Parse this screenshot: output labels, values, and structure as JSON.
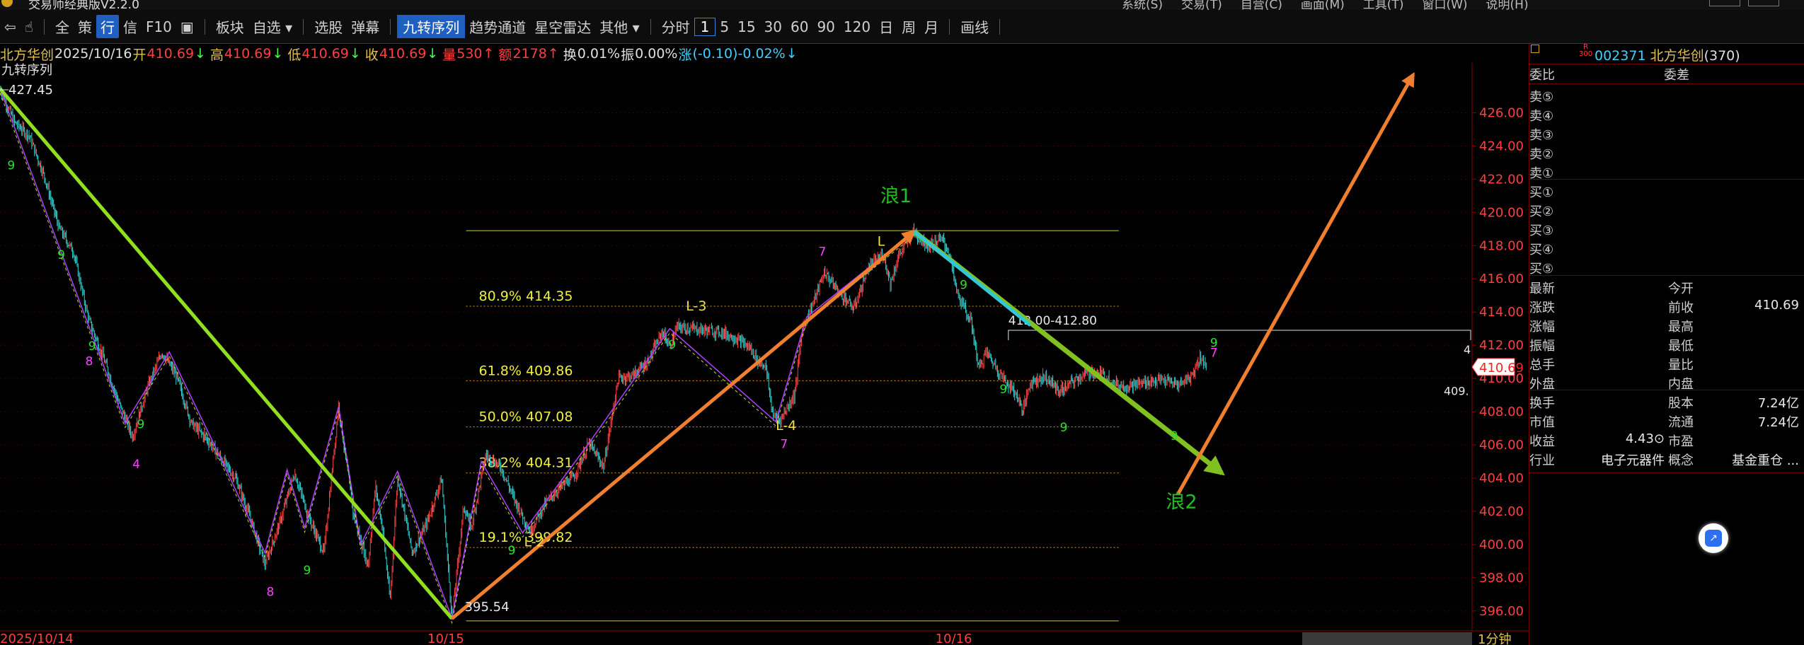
{
  "window": {
    "title": "交易师经典版V2.2.0",
    "menu": [
      "系统(S)",
      "交易(T)",
      "自营(C)",
      "画面(M)",
      "工具(T)",
      "窗口(W)",
      "说明(H)"
    ]
  },
  "toolbar": {
    "items": [
      "板块",
      "自选",
      "选股",
      "弹幕",
      "九转序列",
      "趋势通道",
      "星空雷达",
      "其他",
      "分时",
      "1",
      "5",
      "15",
      "30",
      "60",
      "90",
      "120",
      "日",
      "周",
      "月",
      "画线"
    ],
    "left_icons": [
      "back-icon",
      "pointer-icon"
    ],
    "quick": [
      "全",
      "策",
      "行",
      "信",
      "F10"
    ]
  },
  "stock": {
    "name": "北方华创",
    "code": "002371",
    "count": "(370)",
    "market_tag_top": "R",
    "market_tag_bottom": "300"
  },
  "infoline": [
    {
      "text": "北方华创",
      "color": "#e0c050"
    },
    {
      "text": "2025/10/16",
      "color": "#e0e0e0"
    },
    {
      "text": "开",
      "color": "#e0c050"
    },
    {
      "text": "410.69",
      "color": "#ff4040"
    },
    {
      "text": "↓",
      "color": "#40ff40"
    },
    {
      "text": "高",
      "color": "#e0c050"
    },
    {
      "text": "410.69",
      "color": "#ff4040"
    },
    {
      "text": "↓",
      "color": "#40ff40"
    },
    {
      "text": "低",
      "color": "#e0c050"
    },
    {
      "text": "410.69",
      "color": "#ff4040"
    },
    {
      "text": "↓",
      "color": "#40ff40"
    },
    {
      "text": "收",
      "color": "#e0c050"
    },
    {
      "text": "410.69",
      "color": "#ff4040"
    },
    {
      "text": "↓",
      "color": "#40ff40"
    },
    {
      "text": "量",
      "color": "#ff4040"
    },
    {
      "text": "530",
      "color": "#ff4040"
    },
    {
      "text": "↑",
      "color": "#ff4040"
    },
    {
      "text": "额",
      "color": "#ff4040"
    },
    {
      "text": "2178",
      "color": "#ff4040"
    },
    {
      "text": "↑",
      "color": "#ff4040"
    },
    {
      "text": "换",
      "color": "#e0e0e0"
    },
    {
      "text": "0.01%",
      "color": "#e0e0e0"
    },
    {
      "text": "振",
      "color": "#e0e0e0"
    },
    {
      "text": "0.00%",
      "color": "#e0e0e0"
    },
    {
      "text": "涨",
      "color": "#40d0ff"
    },
    {
      "text": "(-0.10)-0.02%",
      "color": "#40d0ff"
    },
    {
      "text": "↓",
      "color": "#40d0ff"
    }
  ],
  "chart_data": {
    "type": "line",
    "title": "",
    "indicator_label": "九转序列",
    "period_label": "1分钟",
    "max_label": "427.45",
    "min_label": "395.54",
    "x_ticks": [
      "2025/10/14",
      "10/15",
      "10/16"
    ],
    "y_ticks": [
      "426.00",
      "424.00",
      "422.00",
      "420.00",
      "418.00",
      "416.00",
      "414.00",
      "412.00",
      "410.00",
      "408.00",
      "406.00",
      "404.00",
      "402.00",
      "400.00",
      "398.00",
      "396.00"
    ],
    "ylim": [
      394.8,
      429.0
    ],
    "last_price": "410.69",
    "last_price_value": 410.69,
    "fib_levels": [
      {
        "label": "80.9% 414.35",
        "value": 414.35
      },
      {
        "label": "61.8% 409.86",
        "value": 409.86
      },
      {
        "label": "50.0% 407.08",
        "value": 407.08
      },
      {
        "label": "38.2% 404.31",
        "value": 404.31
      },
      {
        "label": "19.1% 399.82",
        "value": 399.82
      }
    ],
    "fib_top": 418.9,
    "fib_bottom": 395.4,
    "range_label": "413.00-412.80",
    "small_label_right": "409.",
    "small_label_right2": "4",
    "wave_labels": [
      {
        "text": "浪1",
        "t": 0.598,
        "v": 420.6,
        "color": "#20c020"
      },
      {
        "text": "浪2",
        "t": 0.792,
        "v": 402.2,
        "color": "#20c020"
      }
    ],
    "swing_labels": [
      {
        "text": "L-3",
        "t": 0.466,
        "v": 414.1,
        "color": "#f0e040"
      },
      {
        "text": "L-2",
        "t": 0.356,
        "v": 399.9,
        "color": "#f0e040"
      },
      {
        "text": "L-4",
        "t": 0.527,
        "v": 406.9,
        "color": "#f0e040"
      },
      {
        "text": "L",
        "t": 0.596,
        "v": 418.0,
        "color": "#f0e040"
      }
    ],
    "trend_lines": [
      {
        "from": [
          0.0,
          427.45
        ],
        "to": [
          0.307,
          395.54
        ],
        "color": "#90e020",
        "width": 5
      },
      {
        "from": [
          0.307,
          395.54
        ],
        "to": [
          0.621,
          418.85
        ],
        "color": "#f08030",
        "width": 5
      },
      {
        "from": [
          0.621,
          418.85
        ],
        "to": [
          0.83,
          404.3
        ],
        "color": "#80c020",
        "width": 7
      },
      {
        "from": [
          0.621,
          418.85
        ],
        "to": [
          0.7,
          413.2
        ],
        "color": "#30c8d8",
        "width": 5
      },
      {
        "from": [
          0.8,
          403.0
        ],
        "to": [
          0.96,
          428.3
        ],
        "color": "#f08030",
        "width": 5
      }
    ],
    "price_path": [
      [
        0.0,
        427.45
      ],
      [
        0.01,
        425.4
      ],
      [
        0.02,
        424.6
      ],
      [
        0.03,
        422.2
      ],
      [
        0.04,
        419.1
      ],
      [
        0.05,
        417.6
      ],
      [
        0.06,
        413.6
      ],
      [
        0.07,
        411.3
      ],
      [
        0.08,
        408.7
      ],
      [
        0.09,
        406.5
      ],
      [
        0.1,
        409.4
      ],
      [
        0.11,
        411.6
      ],
      [
        0.12,
        410.1
      ],
      [
        0.13,
        407.3
      ],
      [
        0.14,
        406.4
      ],
      [
        0.15,
        405.2
      ],
      [
        0.16,
        404.0
      ],
      [
        0.17,
        401.6
      ],
      [
        0.18,
        398.8
      ],
      [
        0.19,
        401.3
      ],
      [
        0.2,
        404.3
      ],
      [
        0.21,
        401.6
      ],
      [
        0.22,
        399.5
      ],
      [
        0.23,
        408.4
      ],
      [
        0.24,
        401.8
      ],
      [
        0.25,
        398.7
      ],
      [
        0.255,
        403.5
      ],
      [
        0.26,
        400.9
      ],
      [
        0.265,
        396.6
      ],
      [
        0.27,
        404.1
      ],
      [
        0.28,
        399.5
      ],
      [
        0.29,
        401.3
      ],
      [
        0.3,
        404.0
      ],
      [
        0.307,
        395.54
      ],
      [
        0.315,
        402.3
      ],
      [
        0.32,
        401.0
      ],
      [
        0.33,
        405.4
      ],
      [
        0.34,
        404.7
      ],
      [
        0.35,
        402.6
      ],
      [
        0.355,
        401.7
      ],
      [
        0.36,
        400.8
      ],
      [
        0.37,
        402.4
      ],
      [
        0.38,
        403.4
      ],
      [
        0.39,
        404.1
      ],
      [
        0.4,
        406.1
      ],
      [
        0.41,
        404.7
      ],
      [
        0.42,
        410.0
      ],
      [
        0.43,
        410.2
      ],
      [
        0.44,
        411.0
      ],
      [
        0.45,
        412.8
      ],
      [
        0.455,
        411.9
      ],
      [
        0.46,
        413.1
      ],
      [
        0.47,
        413.0
      ],
      [
        0.48,
        412.9
      ],
      [
        0.49,
        412.8
      ],
      [
        0.5,
        412.4
      ],
      [
        0.51,
        411.8
      ],
      [
        0.515,
        411.0
      ],
      [
        0.52,
        410.8
      ],
      [
        0.525,
        407.8
      ],
      [
        0.53,
        407.5
      ],
      [
        0.54,
        409.1
      ],
      [
        0.545,
        413.0
      ],
      [
        0.55,
        414.0
      ],
      [
        0.56,
        416.4
      ],
      [
        0.57,
        415.2
      ],
      [
        0.58,
        414.2
      ],
      [
        0.59,
        416.7
      ],
      [
        0.6,
        417.5
      ],
      [
        0.605,
        415.7
      ],
      [
        0.61,
        417.3
      ],
      [
        0.62,
        418.85
      ],
      [
        0.63,
        418.0
      ],
      [
        0.64,
        418.4
      ],
      [
        0.645,
        417.5
      ],
      [
        0.65,
        415.2
      ],
      [
        0.66,
        413.3
      ],
      [
        0.665,
        410.6
      ],
      [
        0.67,
        411.6
      ],
      [
        0.68,
        410.2
      ],
      [
        0.69,
        409.1
      ],
      [
        0.695,
        408.1
      ],
      [
        0.7,
        409.8
      ],
      [
        0.71,
        410.1
      ],
      [
        0.72,
        409.2
      ],
      [
        0.73,
        409.9
      ],
      [
        0.74,
        410.4
      ],
      [
        0.75,
        410.2
      ],
      [
        0.76,
        409.5
      ],
      [
        0.77,
        409.6
      ],
      [
        0.78,
        409.8
      ],
      [
        0.79,
        409.9
      ],
      [
        0.8,
        409.6
      ],
      [
        0.81,
        410.2
      ],
      [
        0.815,
        411.3
      ],
      [
        0.82,
        410.69
      ]
    ],
    "zigzag": [
      [
        0.0,
        427.45
      ],
      [
        0.085,
        407.3
      ],
      [
        0.115,
        411.6
      ],
      [
        0.15,
        405.2
      ],
      [
        0.18,
        399.5
      ],
      [
        0.195,
        404.5
      ],
      [
        0.207,
        401.0
      ],
      [
        0.23,
        408.3
      ],
      [
        0.245,
        400.0
      ],
      [
        0.27,
        404.4
      ],
      [
        0.307,
        395.54
      ],
      [
        0.327,
        405.0
      ],
      [
        0.355,
        400.7
      ],
      [
        0.4,
        406.1
      ],
      [
        0.455,
        413.0
      ],
      [
        0.527,
        407.4
      ],
      [
        0.548,
        413.7
      ],
      [
        0.621,
        418.85
      ]
    ],
    "td_labels": [
      {
        "text": "9",
        "t": 0.005,
        "v": 422.6,
        "color": "#30e030"
      },
      {
        "text": "9",
        "t": 0.039,
        "v": 417.2,
        "color": "#30e030"
      },
      {
        "text": "9",
        "t": 0.06,
        "v": 411.7,
        "color": "#30e030"
      },
      {
        "text": "8",
        "t": 0.058,
        "v": 410.8,
        "color": "#ff40ff"
      },
      {
        "text": "9",
        "t": 0.093,
        "v": 407.0,
        "color": "#30e030"
      },
      {
        "text": "4",
        "t": 0.09,
        "v": 404.6,
        "color": "#ff40ff"
      },
      {
        "text": "8",
        "t": 0.181,
        "v": 396.9,
        "color": "#ff40ff"
      },
      {
        "text": "9",
        "t": 0.206,
        "v": 398.2,
        "color": "#30e030"
      },
      {
        "text": "9",
        "t": 0.345,
        "v": 399.4,
        "color": "#30e030"
      },
      {
        "text": "9",
        "t": 0.454,
        "v": 411.8,
        "color": "#30e030"
      },
      {
        "text": "7",
        "t": 0.53,
        "v": 405.8,
        "color": "#ff40ff"
      },
      {
        "text": "7",
        "t": 0.556,
        "v": 417.4,
        "color": "#ff40ff"
      },
      {
        "text": "9",
        "t": 0.652,
        "v": 415.4,
        "color": "#30e030"
      },
      {
        "text": "9",
        "t": 0.679,
        "v": 409.1,
        "color": "#30e030"
      },
      {
        "text": "9",
        "t": 0.72,
        "v": 406.8,
        "color": "#30e030"
      },
      {
        "text": "9",
        "t": 0.795,
        "v": 406.3,
        "color": "#30e030"
      },
      {
        "text": "9",
        "t": 0.822,
        "v": 411.9,
        "color": "#30e030"
      },
      {
        "text": "7",
        "t": 0.822,
        "v": 411.3,
        "color": "#ff40ff"
      }
    ]
  },
  "right_panel": {
    "header": {
      "left": "委比",
      "right": "委差"
    },
    "sells": [
      "卖⑤",
      "卖④",
      "卖③",
      "卖②",
      "卖①"
    ],
    "buys": [
      "买①",
      "买②",
      "买③",
      "买④",
      "买⑤"
    ],
    "quote_rows": [
      {
        "l": "最新",
        "m": "今开",
        "v": ""
      },
      {
        "l": "涨跌",
        "m": "前收",
        "v": "410.69"
      },
      {
        "l": "涨幅",
        "m": "最高",
        "v": ""
      },
      {
        "l": "振幅",
        "m": "最低",
        "v": ""
      },
      {
        "l": "总手",
        "m": "量比",
        "v": ""
      },
      {
        "l": "外盘",
        "m": "内盘",
        "v": ""
      }
    ],
    "stats_rows": [
      {
        "l": "换手",
        "v1": "",
        "m": "股本",
        "v": "7.24亿"
      },
      {
        "l": "市值",
        "v1": "",
        "m": "流通",
        "v": "7.24亿"
      },
      {
        "l": "收益",
        "v1": "4.43⊙",
        "m": "市盈",
        "v": ""
      },
      {
        "l": "行业",
        "v1": "电子元器件",
        "m": "概念",
        "v": "基金重仓 ..."
      }
    ]
  },
  "colors": {
    "up": "#ff4040",
    "down": "#30e030",
    "grid": "#5a0000",
    "axis_text": "#ff4040"
  }
}
